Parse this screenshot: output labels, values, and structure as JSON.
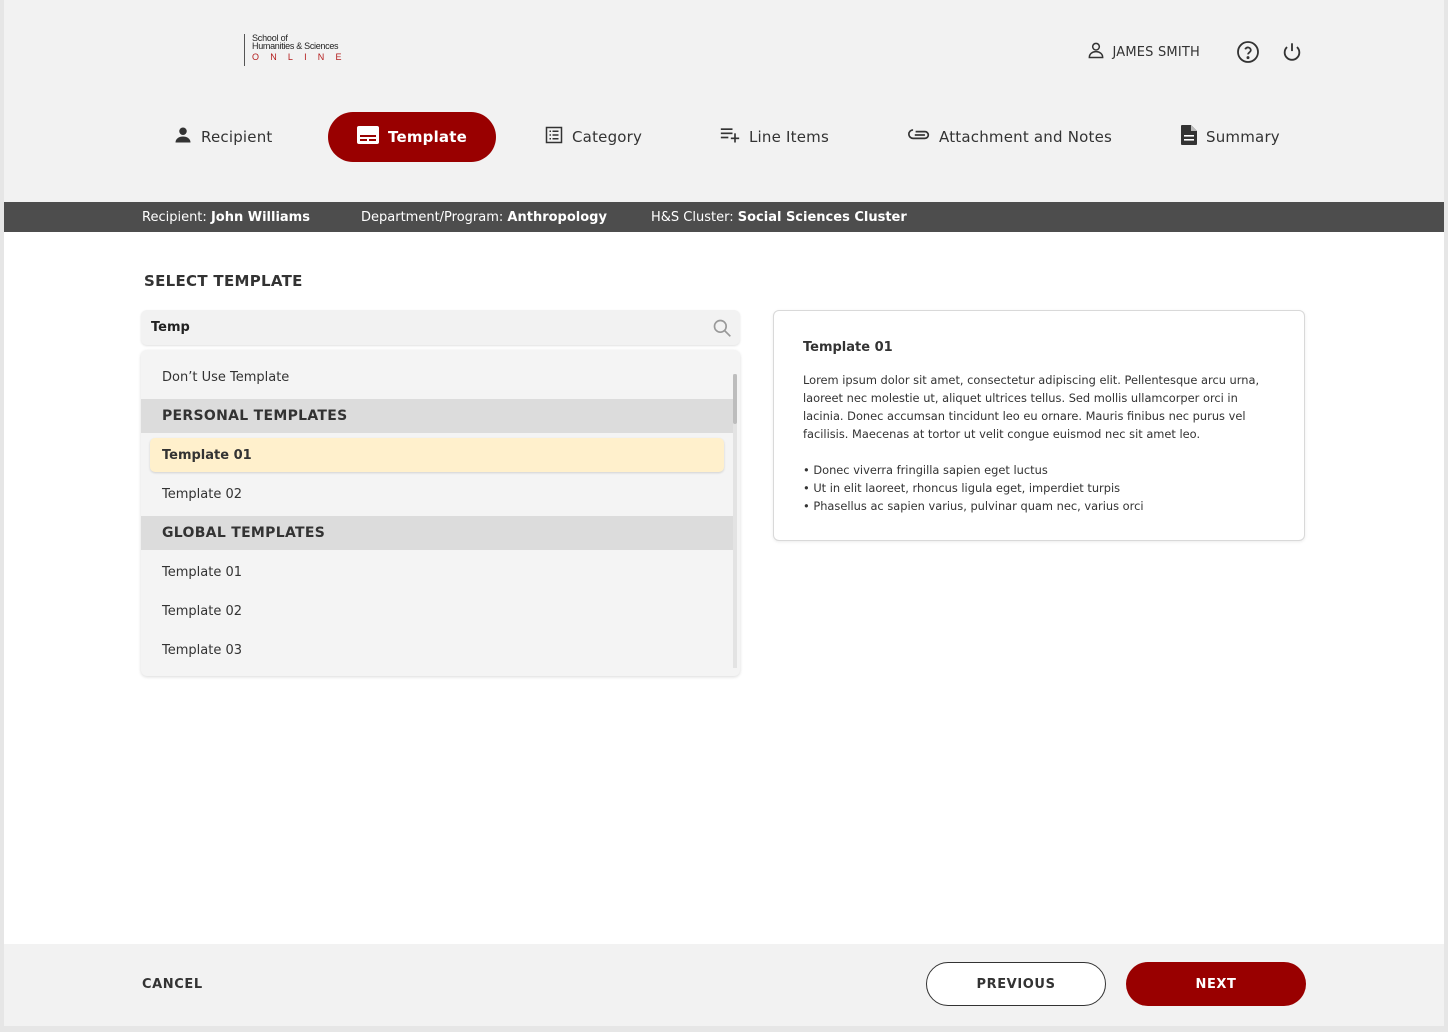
{
  "logo": {
    "line1": "School of",
    "line2": "Humanities & Sciences",
    "line3": "ONLINE"
  },
  "header": {
    "user_name": "JAMES SMITH",
    "icons": [
      "user-icon",
      "help-icon",
      "power-icon"
    ]
  },
  "steps": [
    {
      "label": "Recipient",
      "icon": "person-icon",
      "active": false
    },
    {
      "label": "Template",
      "icon": "template-icon",
      "active": true
    },
    {
      "label": "Category",
      "icon": "list-box-icon",
      "active": false
    },
    {
      "label": "Line Items",
      "icon": "playlist-add-icon",
      "active": false
    },
    {
      "label": "Attachment and Notes",
      "icon": "paperclip-icon",
      "active": false
    },
    {
      "label": "Summary",
      "icon": "document-icon",
      "active": false
    }
  ],
  "context": {
    "recipient_label": "Recipient:",
    "recipient_value": "John Williams",
    "dept_label": "Department/Program:",
    "dept_value": "Anthropology",
    "cluster_label": "H&S Cluster:",
    "cluster_value": "Social Sciences Cluster"
  },
  "main": {
    "section_title": "SELECT TEMPLATE",
    "search_value": "Temp",
    "dropdown": {
      "dont_use": "Don’t Use Template",
      "personal_header": "PERSONAL TEMPLATES",
      "personal": [
        "Template 01",
        "Template 02"
      ],
      "global_header": "GLOBAL TEMPLATES",
      "global": [
        "Template 01",
        "Template 02",
        "Template 03"
      ],
      "selected": "Template 01"
    },
    "preview": {
      "title": "Template 01",
      "body": "Lorem ipsum dolor sit amet, consectetur adipiscing elit. Pellentesque arcu urna, laoreet nec molestie ut, aliquet ultrices tellus. Sed mollis ullamcorper orci in lacinia. Donec accumsan tincidunt leo eu ornare. Mauris finibus nec purus vel facilisis. Maecenas at tortor ut velit congue euismod nec sit amet leo.",
      "bullets": [
        "• Donec viverra fringilla sapien eget luctus",
        "• Ut in elit laoreet, rhoncus ligula eget, imperdiet turpis",
        "• Phasellus ac sapien varius, pulvinar quam nec, varius orci"
      ]
    }
  },
  "footer": {
    "cancel": "CANCEL",
    "previous": "PREVIOUS",
    "next": "NEXT"
  },
  "colors": {
    "accent": "#990000",
    "context_bar": "#4d4d4d",
    "selected_row": "#fff0cc",
    "header_bg": "#f2f2f2"
  }
}
